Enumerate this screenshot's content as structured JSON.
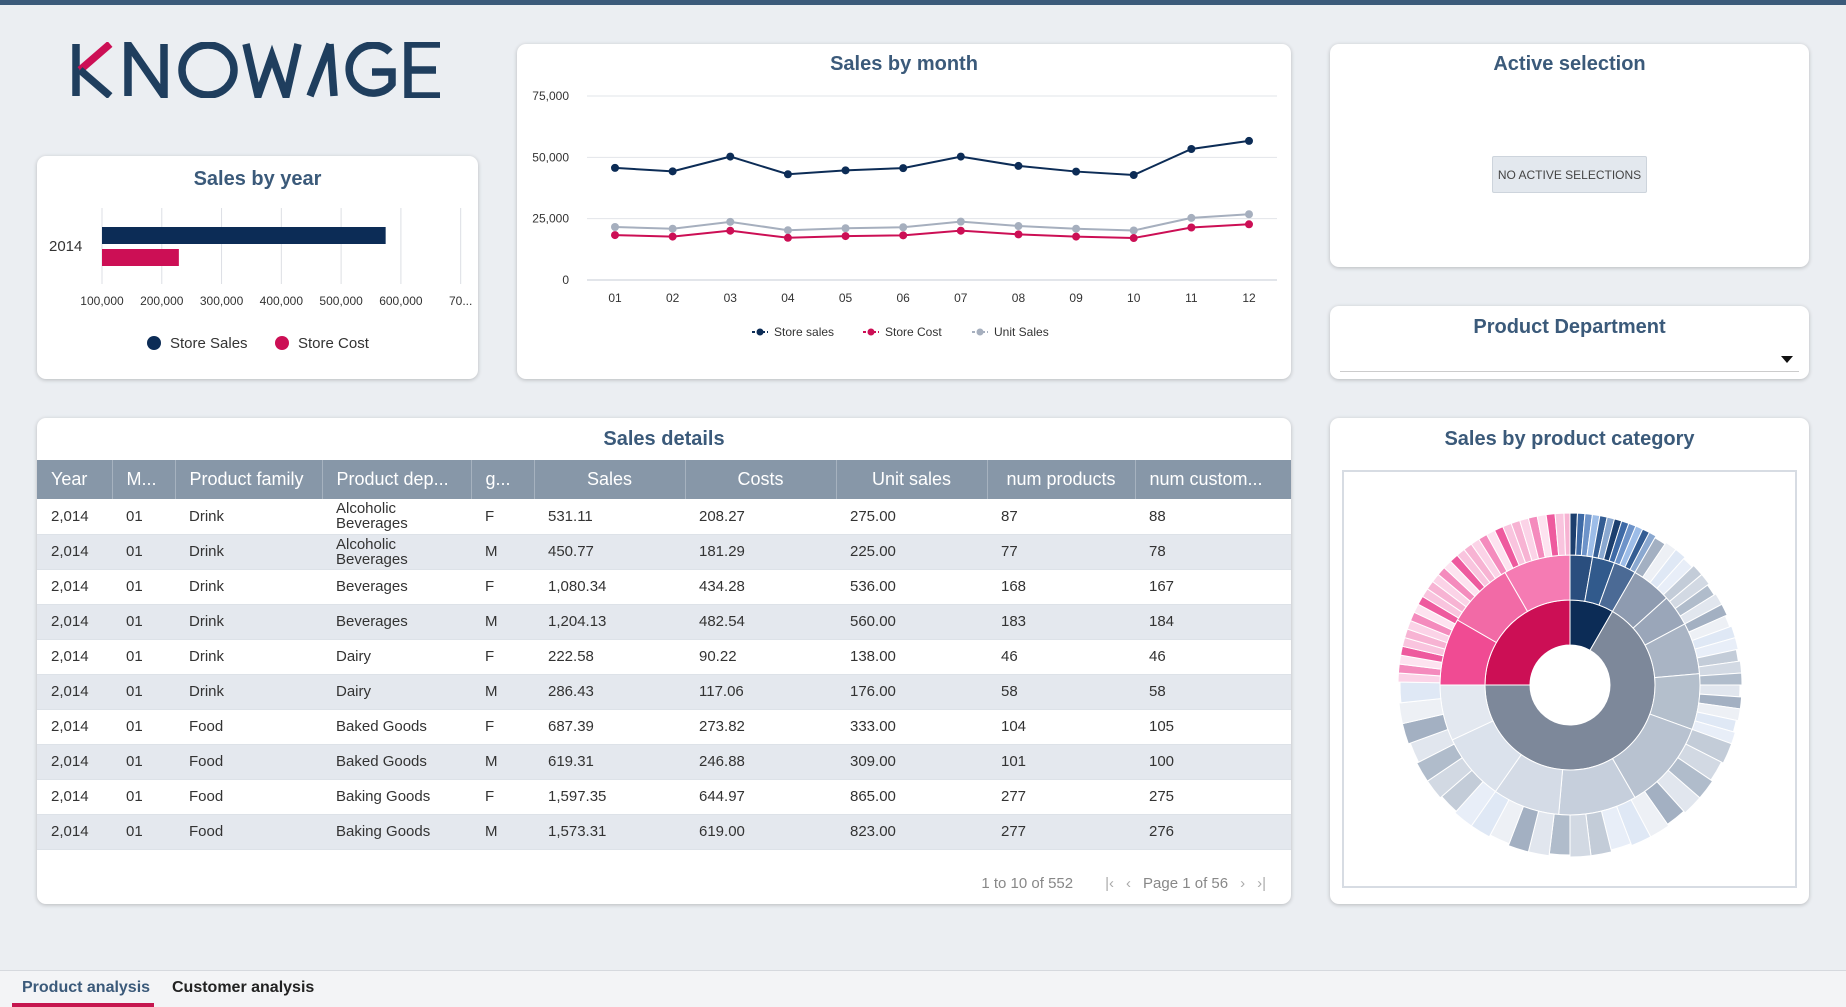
{
  "logo": {
    "text": "KNOWAGE"
  },
  "colors": {
    "navy": "#0c2c56",
    "magenta": "#cc0f55",
    "grey": "#a6afbe",
    "title": "#3b5a7a"
  },
  "sales_by_year": {
    "title": "Sales by year",
    "legend": [
      "Store Sales",
      "Store Cost"
    ]
  },
  "sales_by_month": {
    "title": "Sales by month",
    "legend": [
      "Store sales",
      "Store Cost",
      "Unit Sales"
    ]
  },
  "active_selection": {
    "title": "Active selection",
    "empty_label": "NO ACTIVE SELECTIONS"
  },
  "product_department": {
    "title": "Product Department",
    "selected": ""
  },
  "sales_details": {
    "title": "Sales details",
    "columns": [
      "Year",
      "M...",
      "Product family",
      "Product dep...",
      "g...",
      "Sales",
      "Costs",
      "Unit sales",
      "num products",
      "num custom..."
    ],
    "rows": [
      [
        "2,014",
        "01",
        "Drink",
        "Alcoholic Beverages",
        "F",
        "531.11",
        "208.27",
        "275.00",
        "87",
        "88"
      ],
      [
        "2,014",
        "01",
        "Drink",
        "Alcoholic Beverages",
        "M",
        "450.77",
        "181.29",
        "225.00",
        "77",
        "78"
      ],
      [
        "2,014",
        "01",
        "Drink",
        "Beverages",
        "F",
        "1,080.34",
        "434.28",
        "536.00",
        "168",
        "167"
      ],
      [
        "2,014",
        "01",
        "Drink",
        "Beverages",
        "M",
        "1,204.13",
        "482.54",
        "560.00",
        "183",
        "184"
      ],
      [
        "2,014",
        "01",
        "Drink",
        "Dairy",
        "F",
        "222.58",
        "90.22",
        "138.00",
        "46",
        "46"
      ],
      [
        "2,014",
        "01",
        "Drink",
        "Dairy",
        "M",
        "286.43",
        "117.06",
        "176.00",
        "58",
        "58"
      ],
      [
        "2,014",
        "01",
        "Food",
        "Baked Goods",
        "F",
        "687.39",
        "273.82",
        "333.00",
        "104",
        "105"
      ],
      [
        "2,014",
        "01",
        "Food",
        "Baked Goods",
        "M",
        "619.31",
        "246.88",
        "309.00",
        "101",
        "100"
      ],
      [
        "2,014",
        "01",
        "Food",
        "Baking Goods",
        "F",
        "1,597.35",
        "644.97",
        "865.00",
        "277",
        "275"
      ],
      [
        "2,014",
        "01",
        "Food",
        "Baking Goods",
        "M",
        "1,573.31",
        "619.00",
        "823.00",
        "277",
        "276"
      ]
    ],
    "pager": {
      "summary": "1 to 10 of 552",
      "page": "Page 1 of 56"
    }
  },
  "sales_by_product_category": {
    "title": "Sales by product category"
  },
  "tabs": [
    "Product analysis",
    "Customer analysis"
  ],
  "chart_data": [
    {
      "type": "bar",
      "title": "Sales by year",
      "categories": [
        "2014"
      ],
      "series": [
        {
          "name": "Store Sales",
          "values": [
            565000
          ]
        },
        {
          "name": "Store Cost",
          "values": [
            226000
          ]
        }
      ],
      "xlim": [
        100000,
        700000
      ],
      "xticks": [
        "100,000",
        "200,000",
        "300,000",
        "400,000",
        "500,000",
        "600,000",
        "70..."
      ],
      "orientation": "horizontal",
      "legend": "bottom"
    },
    {
      "type": "line",
      "title": "Sales by month",
      "x": [
        "01",
        "02",
        "03",
        "04",
        "05",
        "06",
        "07",
        "08",
        "09",
        "10",
        "11",
        "12"
      ],
      "series": [
        {
          "name": "Store sales",
          "values": [
            45700,
            44300,
            50300,
            43100,
            44700,
            45600,
            50300,
            46500,
            44200,
            42800,
            53400,
            56700
          ]
        },
        {
          "name": "Store Cost",
          "values": [
            18300,
            17700,
            20100,
            17200,
            17900,
            18200,
            20100,
            18600,
            17700,
            17100,
            21400,
            22700
          ]
        },
        {
          "name": "Unit Sales",
          "values": [
            21600,
            20900,
            23700,
            20300,
            21100,
            21500,
            23800,
            22000,
            20900,
            20200,
            25300,
            26800
          ]
        }
      ],
      "ylim": [
        0,
        75000
      ],
      "yticks": [
        "0",
        "25,000",
        "50,000",
        "75,000"
      ],
      "grid": true,
      "legend": "bottom"
    }
  ]
}
